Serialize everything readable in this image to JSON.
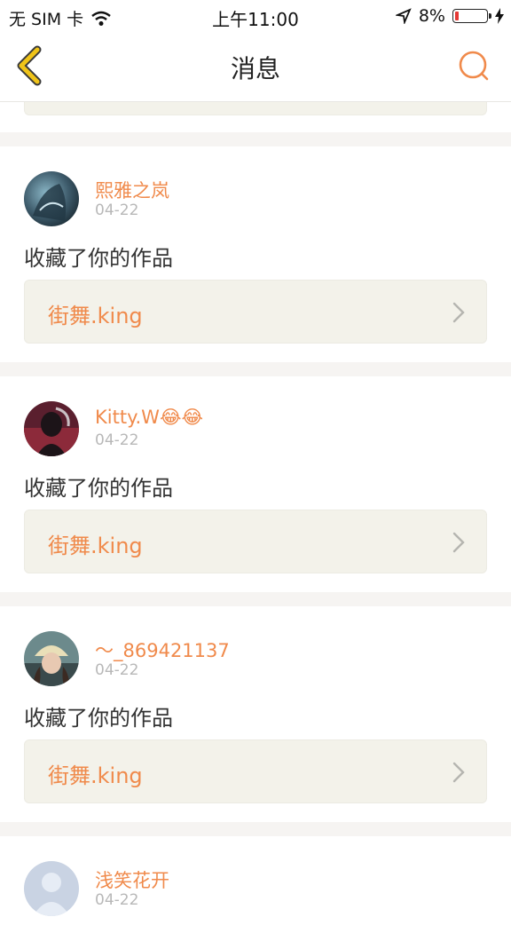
{
  "status_bar": {
    "carrier": "无 SIM 卡",
    "time": "上午11:00",
    "battery": "8%",
    "battery_level": 0.08
  },
  "nav": {
    "title": "消息"
  },
  "colors": {
    "accent": "#f08a4b",
    "back_icon": "#f0c419",
    "card_tile_bg": "#f3f2ea"
  },
  "messages": [
    {
      "user": "熙雅之岚",
      "date": "04-22",
      "action": "收藏了你的作品",
      "work_title": "街舞.king",
      "emoji": ""
    },
    {
      "user": "Kitty.W",
      "date": "04-22",
      "action": "收藏了你的作品",
      "work_title": "街舞.king",
      "emoji": "😂😂"
    },
    {
      "user": "～_869421137",
      "date": "04-22",
      "action": "收藏了你的作品",
      "work_title": "街舞.king",
      "emoji": ""
    },
    {
      "user": "浅笑花开",
      "date": "04-22"
    }
  ]
}
